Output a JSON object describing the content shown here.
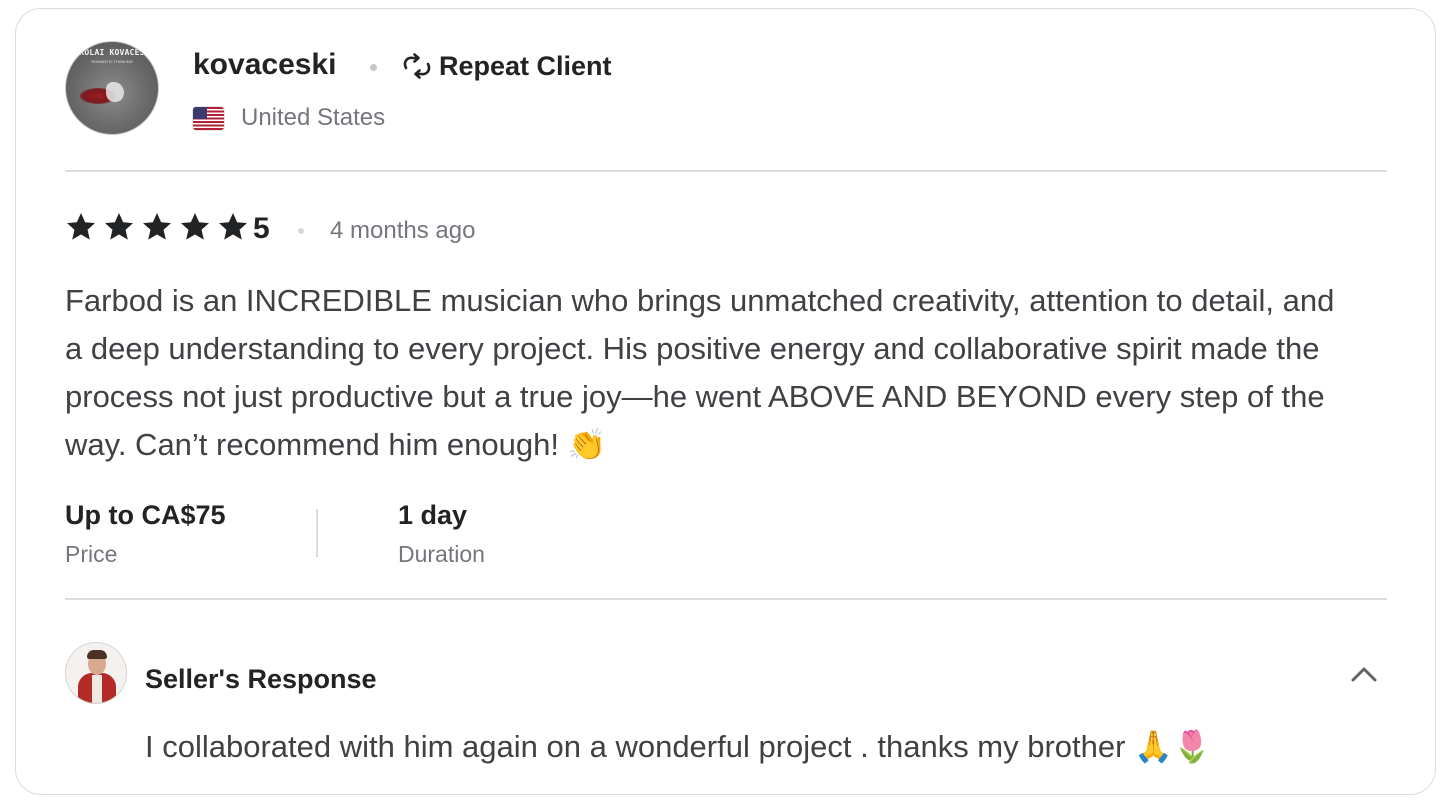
{
  "reviewer": {
    "username": "kovaceski",
    "badge": "Repeat Client",
    "country": "United States",
    "avatar_cover_title": "NIKOLAI KOVACESKI",
    "avatar_cover_subtitle": "ROMANTIC THINKING"
  },
  "review": {
    "rating": "5",
    "star_count": 5,
    "time_ago": "4 months ago",
    "text": "Farbod is an INCREDIBLE musician who brings unmatched creativity, attention to detail, and a deep understanding to every project. His positive energy and collaborative spirit made the process not just productive but a true joy—he went ABOVE AND BEYOND every step of the way. Can’t recommend him enough! 👏"
  },
  "meta": {
    "price_value": "Up to CA$75",
    "price_label": "Price",
    "duration_value": "1 day",
    "duration_label": "Duration"
  },
  "seller_response": {
    "title": "Seller's Response",
    "text": "I collaborated with him again on a wonderful project . thanks my brother 🙏🌷",
    "expanded": true
  },
  "icons": {
    "star": "star-icon",
    "repeat": "repeat-icon",
    "flag": "us-flag-icon",
    "collapse": "chevron-up-icon"
  },
  "colors": {
    "text_primary": "#222325",
    "text_body": "#404145",
    "text_muted": "#74767e",
    "border": "#dadbdd",
    "star": "#222325"
  }
}
